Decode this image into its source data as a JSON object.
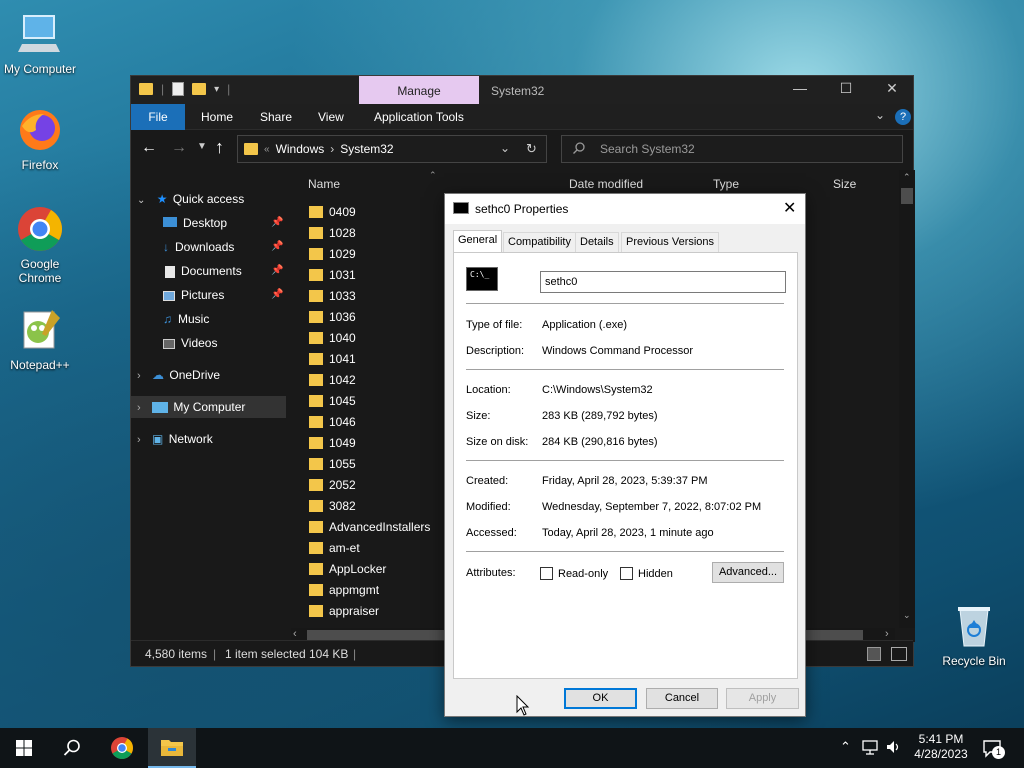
{
  "desktop": {
    "icons": [
      {
        "label": "My Computer"
      },
      {
        "label": "Firefox"
      },
      {
        "label": "Google Chrome"
      },
      {
        "label": "Notepad++"
      },
      {
        "label": "Recycle Bin"
      }
    ]
  },
  "explorer": {
    "manage_tab": "Manage",
    "title": "System32",
    "ribbon_tabs": [
      "File",
      "Home",
      "Share",
      "View",
      "Application Tools"
    ],
    "breadcrumb": [
      "Windows",
      "System32"
    ],
    "search_placeholder": "Search System32",
    "nav": {
      "quick_access": "Quick access",
      "items": [
        "Desktop",
        "Downloads",
        "Documents",
        "Pictures",
        "Music",
        "Videos"
      ],
      "onedrive": "OneDrive",
      "my_computer": "My Computer",
      "network": "Network"
    },
    "columns": [
      "Name",
      "Date modified",
      "Type",
      "Size"
    ],
    "files": [
      "0409",
      "1028",
      "1029",
      "1031",
      "1033",
      "1036",
      "1040",
      "1041",
      "1042",
      "1045",
      "1046",
      "1049",
      "1055",
      "2052",
      "3082",
      "AdvancedInstallers",
      "am-et",
      "AppLocker",
      "appmgmt",
      "appraiser"
    ],
    "status": {
      "items": "4,580 items",
      "selected": "1 item selected",
      "size": "104 KB"
    }
  },
  "dialog": {
    "title": "sethc0 Properties",
    "tabs": [
      "General",
      "Compatibility",
      "Details",
      "Previous Versions"
    ],
    "file_name": "sethc0",
    "fields": {
      "type_label": "Type of file:",
      "type_value": "Application (.exe)",
      "desc_label": "Description:",
      "desc_value": "Windows Command Processor",
      "location_label": "Location:",
      "location_value": "C:\\Windows\\System32",
      "size_label": "Size:",
      "size_value": "283 KB (289,792 bytes)",
      "disk_label": "Size on disk:",
      "disk_value": "284 KB (290,816 bytes)",
      "created_label": "Created:",
      "created_value": "Friday, April 28, 2023, 5:39:37 PM",
      "modified_label": "Modified:",
      "modified_value": "Wednesday, September 7, 2022, 8:07:02 PM",
      "accessed_label": "Accessed:",
      "accessed_value": "Today, April 28, 2023, 1 minute ago",
      "attributes_label": "Attributes:",
      "readonly_label": "Read-only",
      "hidden_label": "Hidden",
      "advanced_label": "Advanced..."
    },
    "buttons": {
      "ok": "OK",
      "cancel": "Cancel",
      "apply": "Apply"
    }
  },
  "taskbar": {
    "time": "5:41 PM",
    "date": "4/28/2023",
    "notification_count": "1"
  }
}
